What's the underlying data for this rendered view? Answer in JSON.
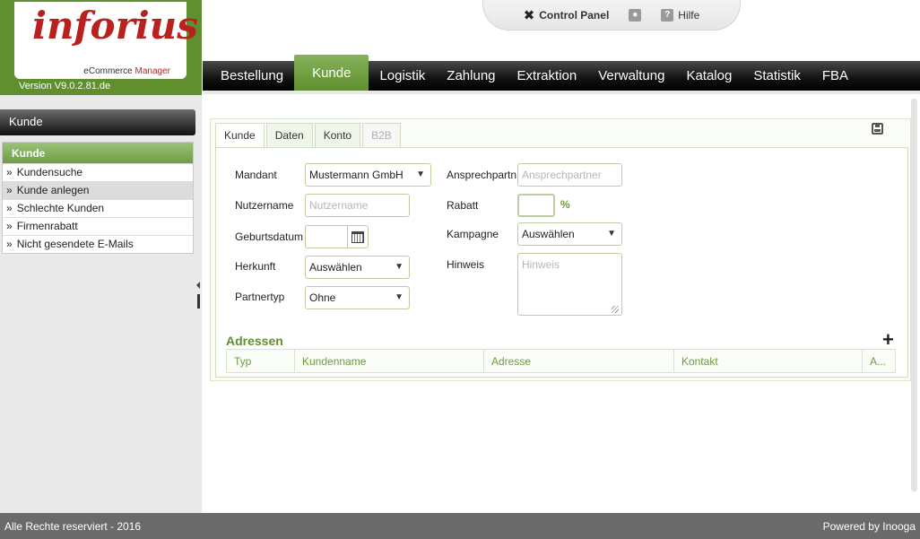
{
  "brand": {
    "logo_text": "inforius",
    "subtitle_prefix": "eCommerce",
    "subtitle_accent": "Manager",
    "version": "Version V9.0.2.81.de"
  },
  "top_panel": {
    "control_panel": "Control Panel",
    "help": "Hilfe"
  },
  "nav": {
    "items": [
      "Bestellung",
      "Kunde",
      "Logistik",
      "Zahlung",
      "Extraktion",
      "Verwaltung",
      "Katalog",
      "Statistik",
      "FBA"
    ],
    "active": "Kunde"
  },
  "sidebar": {
    "header": "Kunde",
    "menu_title": "Kunde",
    "items": [
      "Kundensuche",
      "Kunde anlegen",
      "Schlechte Kunden",
      "Firmenrabatt",
      "Nicht gesendete E-Mails"
    ],
    "selected": "Kunde anlegen",
    "arrow": "»"
  },
  "tabs": [
    "Kunde",
    "Daten",
    "Konto",
    "B2B"
  ],
  "form": {
    "mandant": {
      "label": "Mandant",
      "value": "Mustermann GmbH"
    },
    "nutzername": {
      "label": "Nutzername",
      "placeholder": "Nutzername"
    },
    "geburtsdatum": {
      "label": "Geburtsdatum",
      "value": ""
    },
    "herkunft": {
      "label": "Herkunft",
      "value": "Auswählen"
    },
    "partnertyp": {
      "label": "Partnertyp",
      "value": "Ohne"
    },
    "ansprechpartner": {
      "label": "Ansprechpartn",
      "placeholder": "Ansprechpartner"
    },
    "rabatt": {
      "label": "Rabatt",
      "value": "",
      "unit": "%"
    },
    "kampagne": {
      "label": "Kampagne",
      "value": "Auswählen"
    },
    "hinweis": {
      "label": "Hinweis",
      "placeholder": "Hinweis"
    }
  },
  "addresses": {
    "title": "Adressen",
    "add": "+",
    "columns": [
      "Typ",
      "Kundenname",
      "Adresse",
      "Kontakt",
      "A..."
    ]
  },
  "footer": {
    "left": "Alle Rechte reserviert - 2016",
    "right": "Powered by Inooga"
  },
  "colors": {
    "accent_green": "#5f8f2f",
    "logo_red": "#b8211e",
    "nav_black": "#111111",
    "footer_grey": "#6a6a6a"
  },
  "icons": {
    "control_panel": "tools-icon",
    "user": "user-icon",
    "help": "help-icon",
    "save": "save-icon",
    "calendar": "calendar-icon",
    "caret": "chevron-down-icon"
  }
}
